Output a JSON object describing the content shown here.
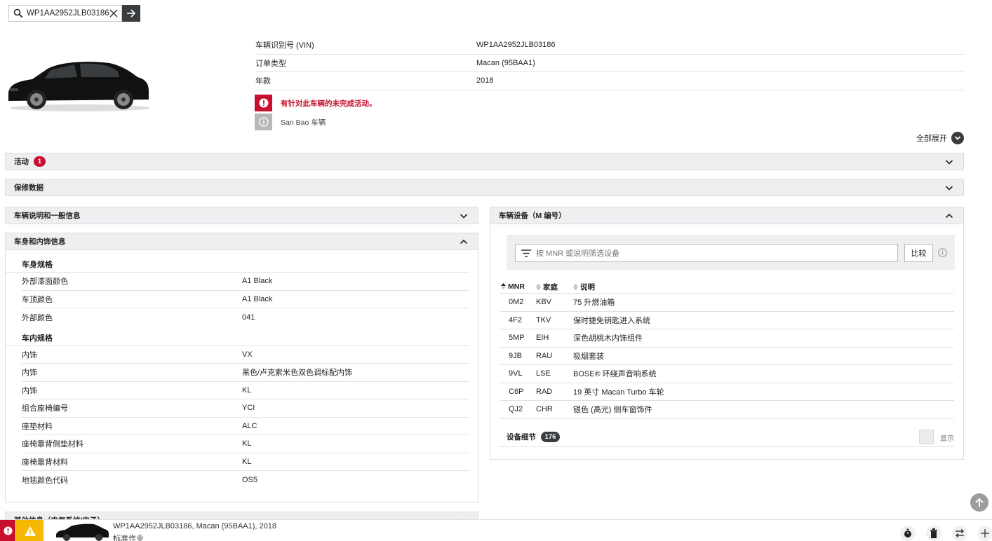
{
  "search": {
    "value": "WP1AA2952JLB03186"
  },
  "vehicle": {
    "rows": [
      {
        "label": "车辆识别号 (VIN)",
        "value": "WP1AA2952JLB03186"
      },
      {
        "label": "订单类型",
        "value": "Macan (95BAA1)"
      },
      {
        "label": "年款",
        "value": "2018"
      }
    ],
    "alert_open_campaign": "有针对此车辆的未完成活动。",
    "info_sanbao": "San Bao 车辆"
  },
  "expand_all_label": "全部展开",
  "sections": {
    "campaigns": {
      "label": "活动",
      "badge": "1"
    },
    "warranty": {
      "label": "保修数据"
    },
    "general": {
      "label": "车辆说明和一般信息"
    },
    "body_interior": {
      "label": "车身和内饰信息"
    },
    "other": {
      "label": "其他信息（电气系统/电子）"
    },
    "equipment": {
      "label": "车辆设备（M 编号）"
    }
  },
  "body_spec": {
    "title": "车身规格",
    "rows": [
      {
        "label": "外部漆面颜色",
        "value": "A1 Black"
      },
      {
        "label": "车顶颜色",
        "value": "A1 Black"
      },
      {
        "label": "外部颜色",
        "value": "041"
      }
    ]
  },
  "interior_spec": {
    "title": "车内规格",
    "rows": [
      {
        "label": "内饰",
        "value": "VX"
      },
      {
        "label": "内饰",
        "value": "黑色/卢克索米色双色调标配内饰"
      },
      {
        "label": "内饰",
        "value": "KL"
      },
      {
        "label": "组合座椅编号",
        "value": "YCI"
      },
      {
        "label": "座垫材料",
        "value": "ALC"
      },
      {
        "label": "座椅靠背侧垫材料",
        "value": "KL"
      },
      {
        "label": "座椅靠背材料",
        "value": "KL"
      },
      {
        "label": "地毯颜色代码",
        "value": "OS5"
      }
    ]
  },
  "equipment": {
    "filter_placeholder": "按 MNR 或说明筛选设备",
    "compare_label": "比较",
    "columns": {
      "mnr": "MNR",
      "family": "家庭",
      "desc": "说明"
    },
    "rows": [
      {
        "mnr": "0M2",
        "family": "KBV",
        "desc": "75 升燃油箱"
      },
      {
        "mnr": "4F2",
        "family": "TKV",
        "desc": "保时捷免钥匙进入系统"
      },
      {
        "mnr": "5MP",
        "family": "EIH",
        "desc": "深色胡桃木内饰组件"
      },
      {
        "mnr": "9JB",
        "family": "RAU",
        "desc": "吸烟套装"
      },
      {
        "mnr": "9VL",
        "family": "LSE",
        "desc": "BOSE® 环绕声音响系统"
      },
      {
        "mnr": "C6P",
        "family": "RAD",
        "desc": "19 英寸 Macan Turbo 车轮"
      },
      {
        "mnr": "QJ2",
        "family": "CHR",
        "desc": "银色 (高光) 侧车窗饰件"
      }
    ],
    "details_label": "设备细节",
    "details_count": "176",
    "show_label": "显示"
  },
  "status_bar": {
    "line1": "WP1AA2952JLB03186, Macan (95BAA1), 2018",
    "line2": "标准作业"
  },
  "colors": {
    "accent_red": "#c8102e",
    "warning_yellow": "#f5b700",
    "dark": "#3a3d40"
  }
}
